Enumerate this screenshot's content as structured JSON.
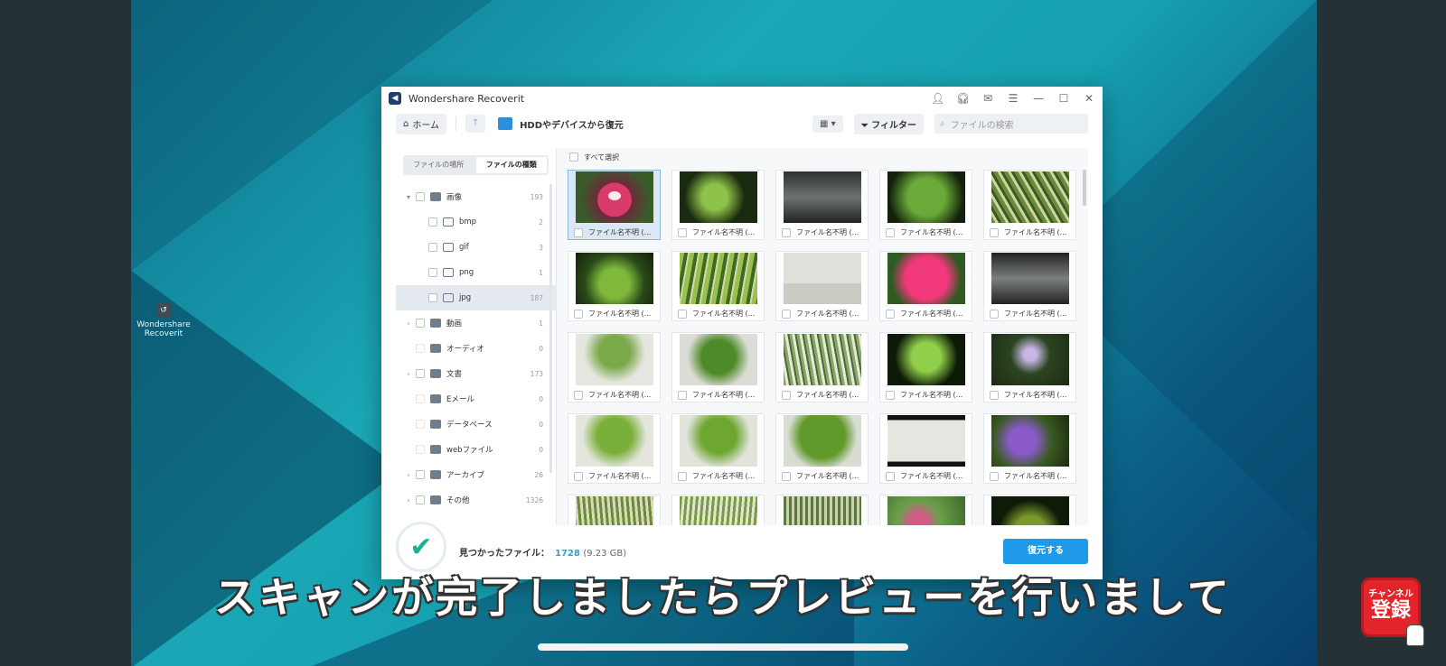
{
  "desktop_icon": {
    "label_line1": "Wondershare",
    "label_line2": "Recoverit"
  },
  "window": {
    "title": "Wondershare Recoverit",
    "toolbar": {
      "home_label": "ホーム",
      "location": "HDDやデバイスから復元",
      "filter_label": "フィルター",
      "search_placeholder": "ファイルの検索"
    },
    "tabs": {
      "location": "ファイルの場所",
      "type": "ファイルの種類"
    },
    "tree": [
      {
        "label": "画像",
        "count": "193",
        "expander": "▾"
      },
      {
        "label": "bmp",
        "count": "2"
      },
      {
        "label": "gif",
        "count": "3"
      },
      {
        "label": "png",
        "count": "1"
      },
      {
        "label": "jpg",
        "count": "187"
      },
      {
        "label": "動画",
        "count": "1",
        "expander": "›"
      },
      {
        "label": "オーディオ",
        "count": "0"
      },
      {
        "label": "文書",
        "count": "173",
        "expander": "›"
      },
      {
        "label": "Eメール",
        "count": "0"
      },
      {
        "label": "データベース",
        "count": "0"
      },
      {
        "label": "webファイル",
        "count": "0"
      },
      {
        "label": "アーカイブ",
        "count": "26",
        "expander": "›"
      },
      {
        "label": "その他",
        "count": "1326",
        "expander": "›"
      }
    ],
    "select_all": "すべて選択",
    "file_label": "ファイル名不明 (...",
    "footer": {
      "found_label": "見つかったファイル：",
      "found_count": "1728",
      "found_size": "(9.23 GB)",
      "recover_button": "復元する"
    }
  },
  "subtitle": "スキャンが完了しましたらプレビューを行いまして",
  "badge": {
    "line1": "チャンネル",
    "line2": "登録"
  }
}
